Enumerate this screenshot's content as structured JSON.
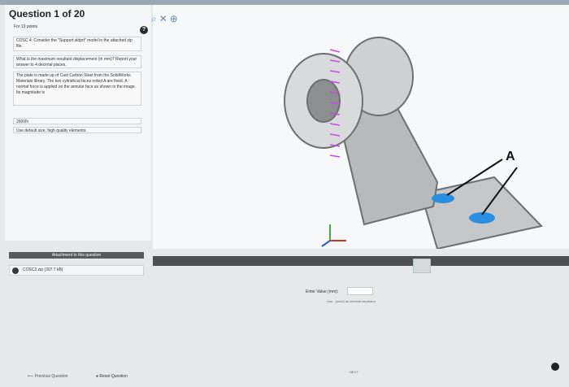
{
  "header": {
    "question_title": "Question 1 of 20",
    "points": "For 13 points"
  },
  "question": {
    "line1": "COSC 4: Consider the \"Support.sldprt\" model in the attached zip file.",
    "line2": "What is the maximum resultant displacement (in mm)? Report your answer to 4 decimal places.",
    "line3": "The plate is made up of Cast Carbon Steel from the SolidWorks Materials library. The two cylindrical faces noted A are fixed. A normal force is applied on the annular face as shown in the image. Its magnitude is",
    "load": "2600N",
    "mesh": "Use default size, high quality elements."
  },
  "attachments": {
    "header": "Attachment to this question",
    "file": "COSC2.zip (307.7 kB)"
  },
  "annotation": {
    "label": "A"
  },
  "answer": {
    "label": "Enter Value (mm):",
    "hint": "Use . (point) as decimal separator",
    "value": ""
  },
  "navigation": {
    "previous": "Previous Question",
    "reset": "Reset Question",
    "next": "NEXT"
  },
  "icons": {
    "help": "help-circle-icon",
    "zoom": "zoom-icon",
    "expand": "expand-icon",
    "zoom_in": "zoom-in-icon"
  },
  "colors": {
    "arrows": "#c24fe0",
    "fixed_faces": "#2a8fe0",
    "dark_band": "#4e4f51"
  }
}
